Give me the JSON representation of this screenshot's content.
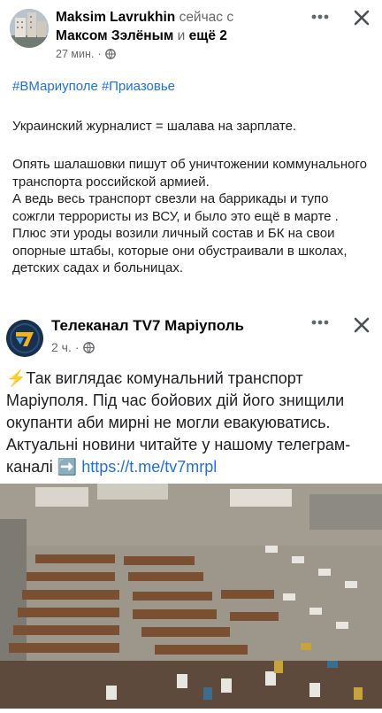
{
  "post": {
    "author": "Maksim Lavrukhin",
    "action_text": "сейчас с",
    "tagged_person": "Максом Зэлёным",
    "conjunction": "и",
    "others": "ещё 2",
    "time": "27 мин.",
    "dot": "·",
    "hashtags": [
      "#ВМариуполе",
      "#Приазовье"
    ],
    "paragraph1": "Украинский журналист = шалава на зарплате.",
    "paragraph2": "Опять шалашовки пишут об уничтожении коммунального транспорта российской армией.",
    "paragraph3": "А ведь весь транспорт свезли на баррикады и тупо сожгли террористы из ВСУ, и было это ещё в марте . Плюс эти уроды  возили личный состав и БК на свои опорные штабы, которые они обустраивали в школах,  детских садах и больницах."
  },
  "shared": {
    "page_name": "Телеканал TV7 Маріуполь",
    "time": "2 ч.",
    "dot": "·",
    "emoji": "⚡",
    "text": "Так виглядає комунальний транспорт Маріуполя. Під час бойових дій його знищили окупанти аби мирні не могли евакуюватись. Актуальні новини читайте у нашому телеграм-каналі",
    "arrow": "➡️",
    "link": "https://t.me/tv7mrpl"
  },
  "icons": [
    "more-icon",
    "close-icon",
    "globe-icon",
    "tv7-logo",
    "aerial-photo"
  ],
  "colors": {
    "link": "#216fdb",
    "meta": "#65676b",
    "logo_bg": "#17304e",
    "logo_accent": "#f2b21a"
  }
}
